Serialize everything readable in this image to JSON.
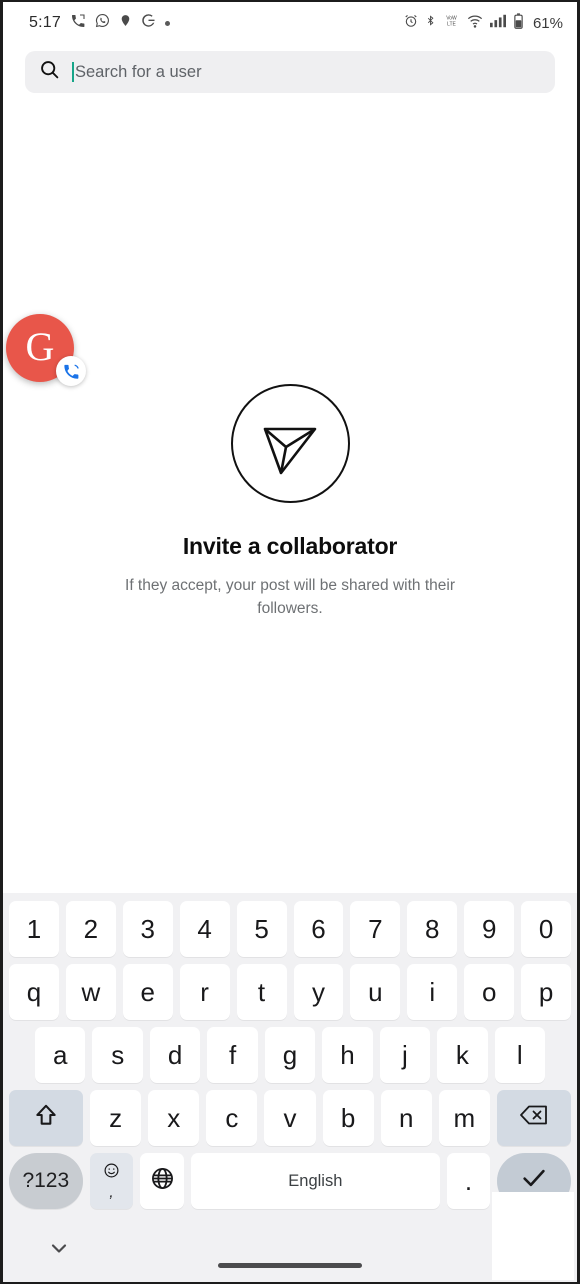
{
  "statusbar": {
    "time": "5:17",
    "notification_icons": [
      "missed-call-icon",
      "whatsapp-icon",
      "location-pin-icon",
      "google-g-icon",
      "dot-icon"
    ],
    "system_icons": [
      "alarm-icon",
      "bluetooth-icon",
      "volte-icon",
      "wifi-icon",
      "cellular-signal-icon",
      "battery-icon"
    ],
    "battery_level": "61%"
  },
  "search": {
    "placeholder": "Search for a user",
    "value": "",
    "icon": "search-icon"
  },
  "floating_bubble": {
    "letter": "G",
    "color": "#e8564a",
    "badge_icon": "phone-call-icon"
  },
  "empty_state": {
    "icon": "send-paper-plane-icon",
    "title": "Invite a collaborator",
    "subtitle": "If they accept, your post will be shared with their followers."
  },
  "keyboard": {
    "row_numbers": [
      "1",
      "2",
      "3",
      "4",
      "5",
      "6",
      "7",
      "8",
      "9",
      "0"
    ],
    "row_top": [
      "q",
      "w",
      "e",
      "r",
      "t",
      "y",
      "u",
      "i",
      "o",
      "p"
    ],
    "row_home": [
      "a",
      "s",
      "d",
      "f",
      "g",
      "h",
      "j",
      "k",
      "l"
    ],
    "row_bottom": [
      "z",
      "x",
      "c",
      "v",
      "b",
      "n",
      "m"
    ],
    "shift_key": "shift-icon",
    "backspace_key": "backspace-icon",
    "symbols_key": "?123",
    "emoji_key_top": "emoji-smiley-icon",
    "emoji_key_bottom": ",",
    "globe_key": "globe-icon",
    "space_key": "English",
    "period_key": ".",
    "enter_key": "checkmark-icon"
  },
  "navbar": {
    "hide_keyboard_icon": "chevron-down-icon",
    "home_pill": "home-gesture-pill"
  },
  "colors": {
    "accent_teal": "#17a589",
    "bubble_red": "#e8564a",
    "keyboard_bg": "#f1f1f3",
    "key_bg": "#ffffff",
    "fn_key_bg": "#d3dae3"
  }
}
